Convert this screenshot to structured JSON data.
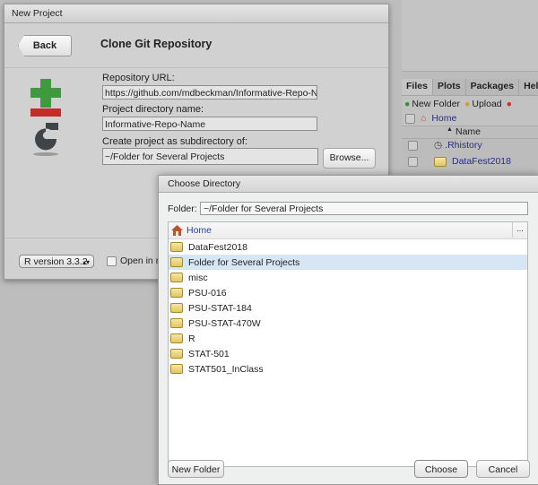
{
  "background_pane": {
    "tabs": [
      "Files",
      "Plots",
      "Packages",
      "Hel"
    ],
    "toolbar": {
      "new_folder": "New Folder",
      "upload": "Upload"
    },
    "home_label": "Home",
    "name_header": "Name",
    "files": [
      ".Rhistory",
      "DataFest2018"
    ]
  },
  "new_project": {
    "window_title": "New Project",
    "back_label": "Back",
    "heading": "Clone Git Repository",
    "repo_url_label": "Repository URL:",
    "repo_url_value": "https://github.com/mdbeckman/Informative-Repo-N",
    "dir_name_label": "Project directory name:",
    "dir_name_value": "Informative-Repo-Name",
    "subdir_label": "Create project as subdirectory of:",
    "subdir_value": "~/Folder for Several Projects",
    "browse_label": "Browse...",
    "r_version": "R version 3.3.2",
    "open_new_session": "Open in n"
  },
  "choose_directory": {
    "title": "Choose Directory",
    "folder_label": "Folder:",
    "folder_value": "~/Folder for Several Projects",
    "home_label": "Home",
    "more_label": "...",
    "folders": [
      {
        "name": "DataFest2018",
        "selected": false
      },
      {
        "name": "Folder for Several Projects",
        "selected": true
      },
      {
        "name": "misc",
        "selected": false
      },
      {
        "name": "PSU-016",
        "selected": false
      },
      {
        "name": "PSU-STAT-184",
        "selected": false
      },
      {
        "name": "PSU-STAT-470W",
        "selected": false
      },
      {
        "name": "R",
        "selected": false
      },
      {
        "name": "STAT-501",
        "selected": false
      },
      {
        "name": "STAT501_InClass",
        "selected": false
      }
    ],
    "new_folder_label": "New Folder",
    "choose_label": "Choose",
    "cancel_label": "Cancel"
  }
}
